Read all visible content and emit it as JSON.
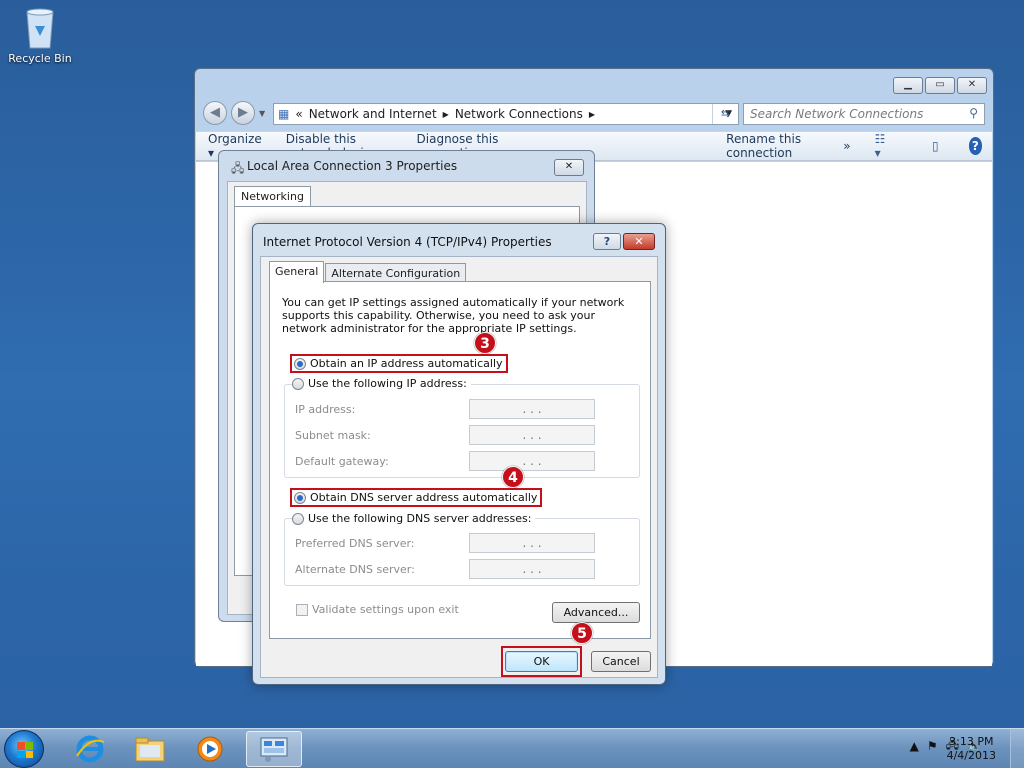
{
  "desktop": {
    "recycle_bin_label": "Recycle Bin"
  },
  "explorer": {
    "breadcrumb": {
      "sep": "«",
      "part1": "Network and Internet",
      "part2": "Network Connections"
    },
    "search_placeholder": "Search Network Connections",
    "toolbar": {
      "organize": "Organize ▾",
      "disable": "Disable this network device",
      "diagnose": "Diagnose this connection",
      "rename": "Rename this connection",
      "more": "»"
    }
  },
  "lan_dialog": {
    "title": "Local Area Connection 3 Properties",
    "tab": "Networking"
  },
  "ipv4_dialog": {
    "title": "Internet Protocol Version 4 (TCP/IPv4) Properties",
    "help_btn": "?",
    "close_btn": "✕",
    "tabs": [
      "General",
      "Alternate Configuration"
    ],
    "intro": "You can get IP settings assigned automatically if your network supports this capability. Otherwise, you need to ask your network administrator for the appropriate IP settings.",
    "ip_auto": "Obtain an IP address automatically",
    "ip_manual": "Use the following IP address:",
    "ip_address_label": "IP address:",
    "subnet_label": "Subnet mask:",
    "gateway_label": "Default gateway:",
    "dns_auto": "Obtain DNS server address automatically",
    "dns_manual": "Use the following DNS server addresses:",
    "preferred_dns_label": "Preferred DNS server:",
    "alternate_dns_label": "Alternate DNS server:",
    "validate_label": "Validate settings upon exit",
    "advanced_btn": "Advanced...",
    "ok_btn": "OK",
    "cancel_btn": "Cancel",
    "ip_dots": ".   .   ."
  },
  "callouts": {
    "step3": "3",
    "step4": "4",
    "step5": "5"
  },
  "taskbar": {
    "time": "3:13 PM",
    "date": "4/4/2013"
  },
  "colors": {
    "highlight": "#c4101a",
    "desktop": "#2f6cb0"
  }
}
